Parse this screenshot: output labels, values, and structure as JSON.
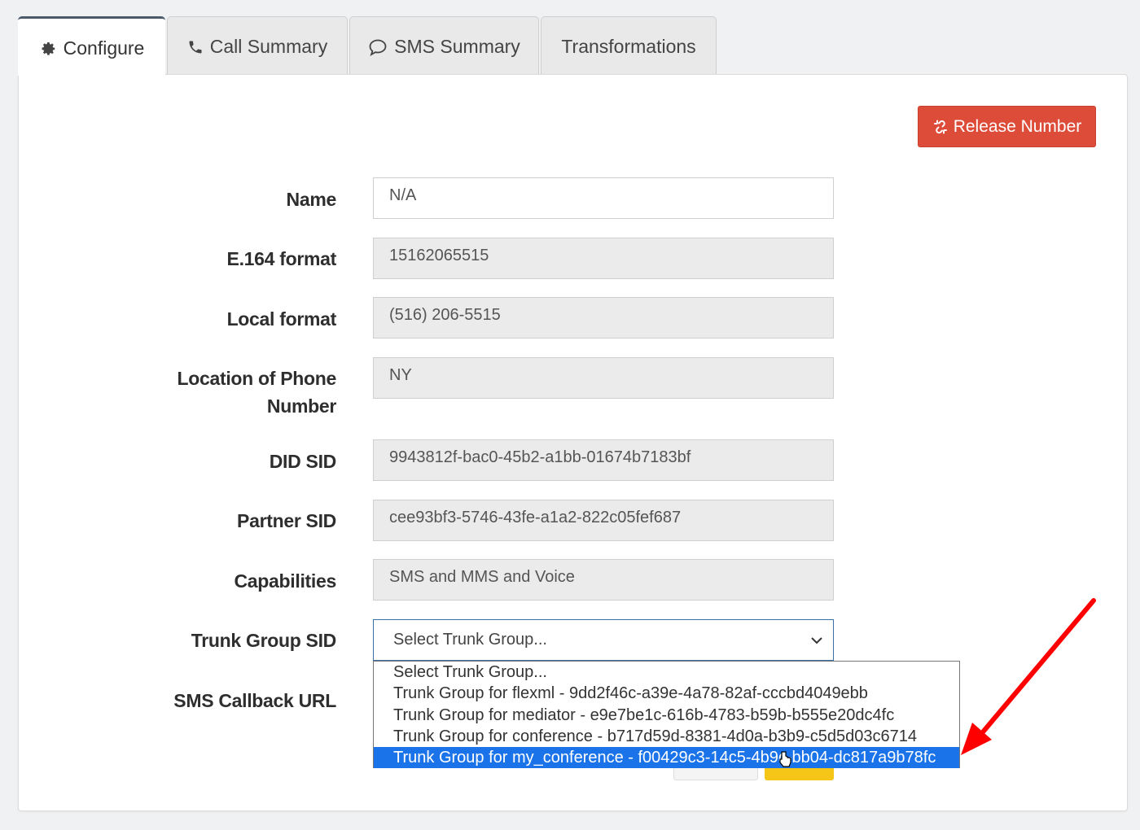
{
  "tabs": [
    {
      "label": "Configure",
      "icon": "gear-icon",
      "active": true
    },
    {
      "label": "Call Summary",
      "icon": "phone-icon",
      "active": false
    },
    {
      "label": "SMS Summary",
      "icon": "chat-bubble-icon",
      "active": false
    },
    {
      "label": "Transformations",
      "icon": "",
      "active": false
    }
  ],
  "release_button": {
    "label": "Release Number",
    "icon": "unlink-icon",
    "color": "#dd4b39"
  },
  "form": {
    "name": {
      "label": "Name",
      "value": "N/A"
    },
    "e164": {
      "label": "E.164 format",
      "value": "15162065515"
    },
    "local": {
      "label": "Local format",
      "value": "(516) 206-5515"
    },
    "location": {
      "label_line1": "Location of Phone",
      "label_line2": "Number",
      "value": "NY"
    },
    "did_sid": {
      "label": "DID SID",
      "value": "9943812f-bac0-45b2-a1bb-01674b7183bf"
    },
    "partner_sid": {
      "label": "Partner SID",
      "value": "cee93bf3-5746-43fe-a1a2-822c05fef687"
    },
    "capabilities": {
      "label": "Capabilities",
      "value": "SMS and MMS and Voice"
    },
    "trunk_group": {
      "label": "Trunk Group SID",
      "selected": "Select Trunk Group..."
    },
    "sms_callback": {
      "label": "SMS Callback URL"
    }
  },
  "trunk_options": [
    "Select Trunk Group...",
    "Trunk Group for flexml - 9dd2f46c-a39e-4a78-82af-cccbd4049ebb",
    "Trunk Group for mediator - e9e7be1c-616b-4783-b59b-b555e20dc4fc",
    "Trunk Group for conference - b717d59d-8381-4d0a-b3b9-c5d5d03c6714",
    "Trunk Group for my_conference - f00429c3-14c5-4b9c-bb04-dc817a9b78fc"
  ],
  "highlighted_option_index": 4,
  "colors": {
    "highlight": "#1a73e8",
    "annotation_arrow": "#ff0000",
    "primary_button": "#f5c518"
  }
}
